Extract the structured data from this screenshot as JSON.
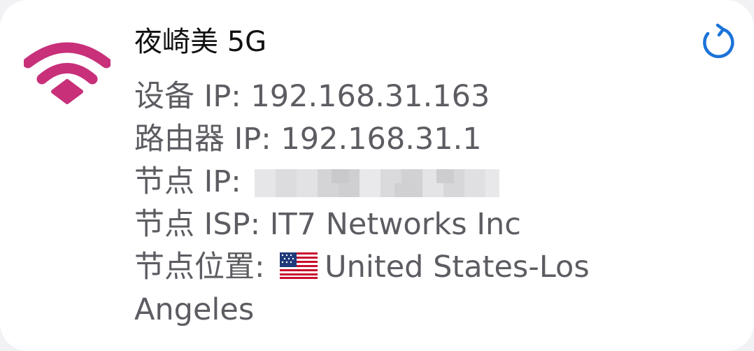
{
  "network": {
    "ssid": "夜崎美 5G"
  },
  "info": {
    "device_ip_label": "设备 IP: ",
    "device_ip": "192.168.31.163",
    "router_ip_label": "路由器 IP: ",
    "router_ip": "192.168.31.1",
    "node_ip_label": "节点 IP: ",
    "node_isp_label": "节点 ISP: ",
    "node_isp": "IT7 Networks Inc",
    "node_location_label": "节点位置: ",
    "node_location": "United States-Los Angeles"
  },
  "icons": {
    "wifi": "wifi-icon",
    "refresh": "refresh-icon",
    "flag": "us-flag-icon"
  },
  "colors": {
    "wifi": "#c8307a",
    "refresh": "#1a73d9",
    "text_primary": "#111111",
    "text_secondary": "#5c5c62"
  }
}
